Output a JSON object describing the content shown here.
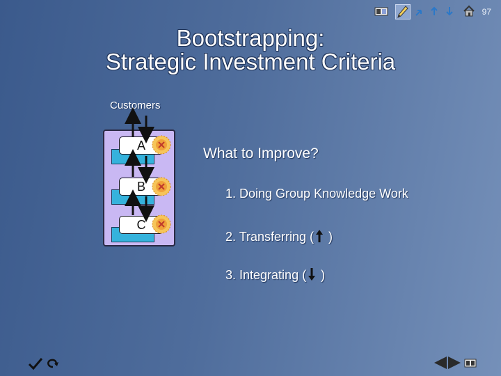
{
  "slide": {
    "page_number": "97",
    "title_line1": "Bootstrapping:",
    "title_line2": "Strategic Investment Criteria"
  },
  "toolbar": {
    "icons": [
      "slide-sorter-icon",
      "pen-icon",
      "undo-icon",
      "redo-icon",
      "down-icon",
      "home-icon"
    ]
  },
  "diagram": {
    "customers_label": "Customers",
    "units": [
      {
        "label": "A"
      },
      {
        "label": "B"
      },
      {
        "label": "C"
      }
    ]
  },
  "content": {
    "heading": "What to Improve?",
    "item1": "1.  Doing Group Knowledge Work",
    "item2_prefix": "2.  Transferring (",
    "item2_suffix": " )",
    "item3_prefix": "3.  Integrating (",
    "item3_suffix": " )"
  },
  "colors": {
    "background": "#4f6d9c",
    "panel": "#c9b8f3",
    "unit_box": "#35b2dc",
    "burst": "#f2b23c"
  }
}
